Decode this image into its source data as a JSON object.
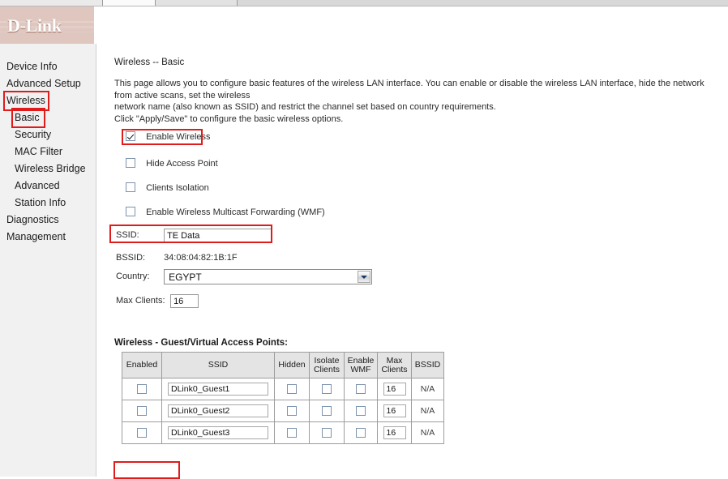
{
  "browser": {
    "tab_strip": "chrome-strip"
  },
  "header": {
    "brand": "D-Link"
  },
  "sidebar": {
    "items": [
      {
        "label": "Device Info",
        "level": 0,
        "highlighted": false
      },
      {
        "label": "Advanced Setup",
        "level": 0,
        "highlighted": false
      },
      {
        "label": "Wireless",
        "level": 0,
        "highlighted": true
      },
      {
        "label": "Basic",
        "level": 1,
        "highlighted": true
      },
      {
        "label": "Security",
        "level": 1,
        "highlighted": false
      },
      {
        "label": "MAC Filter",
        "level": 1,
        "highlighted": false
      },
      {
        "label": "Wireless Bridge",
        "level": 1,
        "highlighted": false
      },
      {
        "label": "Advanced",
        "level": 1,
        "highlighted": false
      },
      {
        "label": "Station Info",
        "level": 1,
        "highlighted": false
      },
      {
        "label": "Diagnostics",
        "level": 0,
        "highlighted": false
      },
      {
        "label": "Management",
        "level": 0,
        "highlighted": false
      }
    ]
  },
  "main": {
    "title": "Wireless -- Basic",
    "intro_line1": "This page allows you to configure basic features of the wireless LAN interface. You can enable or disable the wireless LAN interface, hide the network from active scans, set the wireless",
    "intro_line2": "network name (also known as SSID) and restrict the channel set based on country requirements.",
    "intro_line3": "Click \"Apply/Save\" to configure the basic wireless options.",
    "checkboxes": [
      {
        "label": "Enable Wireless",
        "checked": true
      },
      {
        "label": "Hide Access Point",
        "checked": false
      },
      {
        "label": "Clients Isolation",
        "checked": false
      },
      {
        "label": "Enable Wireless Multicast Forwarding (WMF)",
        "checked": false
      }
    ],
    "fields": {
      "ssid_label": "SSID:",
      "ssid_value": "TE Data",
      "bssid_label": "BSSID:",
      "bssid_value": "34:08:04:82:1B:1F",
      "country_label": "Country:",
      "country_value": "EGYPT",
      "max_clients_label": "Max Clients:",
      "max_clients_value": "16"
    },
    "guest_table": {
      "title": "Wireless - Guest/Virtual Access Points:",
      "headers": {
        "enabled": "Enabled",
        "ssid": "SSID",
        "hidden": "Hidden",
        "isolate_clients": "Isolate Clients",
        "enable_wmf": "Enable WMF",
        "max_clients": "Max Clients",
        "bssid": "BSSID"
      },
      "rows": [
        {
          "enabled": false,
          "ssid": "DLink0_Guest1",
          "hidden": false,
          "isolate": false,
          "wmf": false,
          "max_clients": "16",
          "bssid": "N/A"
        },
        {
          "enabled": false,
          "ssid": "DLink0_Guest2",
          "hidden": false,
          "isolate": false,
          "wmf": false,
          "max_clients": "16",
          "bssid": "N/A"
        },
        {
          "enabled": false,
          "ssid": "DLink0_Guest3",
          "hidden": false,
          "isolate": false,
          "wmf": false,
          "max_clients": "16",
          "bssid": "N/A"
        }
      ]
    }
  },
  "annotations": {
    "color": "#e01b1b",
    "boxes": [
      "sidebar-wireless",
      "sidebar-basic",
      "enable-wireless-checkbox",
      "ssid-field",
      "apply-save-button"
    ]
  }
}
